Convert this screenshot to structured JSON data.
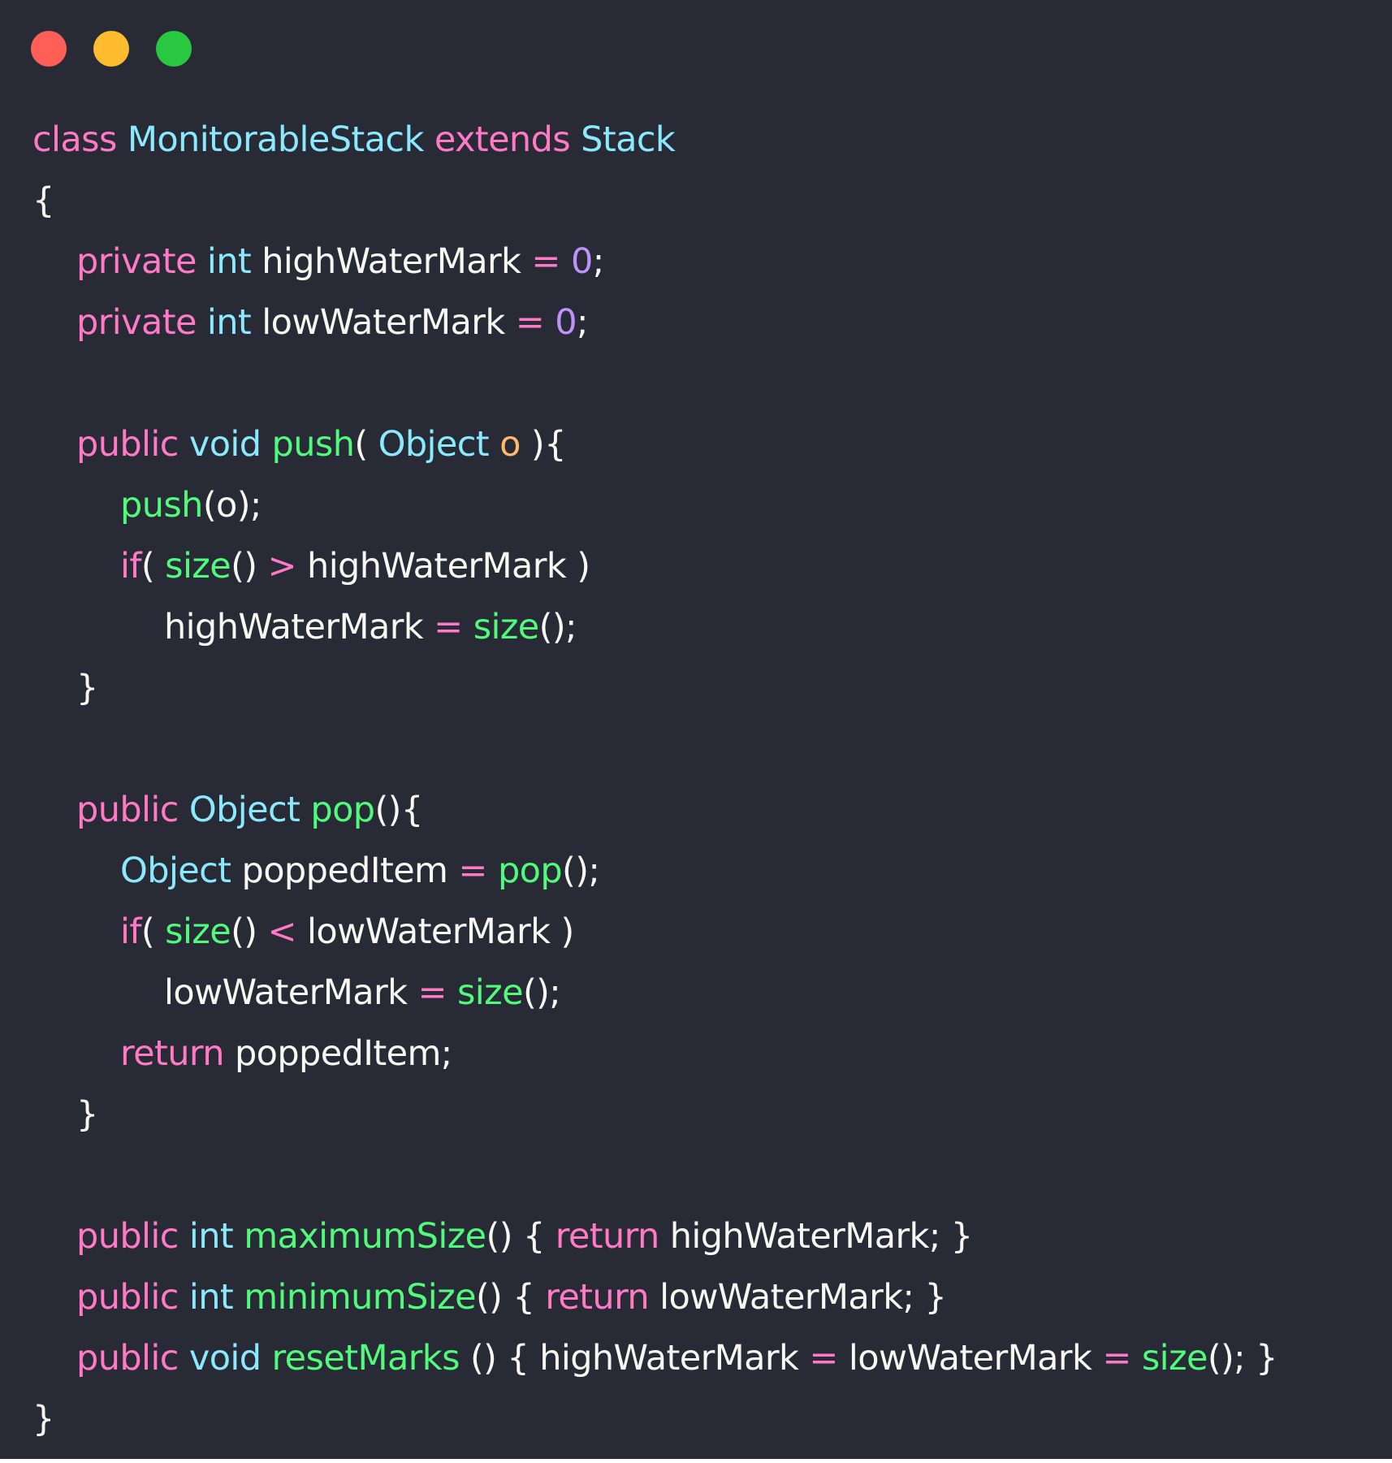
{
  "window": {
    "controls": {
      "close_color": "#ff5f57",
      "minimize_color": "#febc2e",
      "zoom_color": "#28c840"
    }
  },
  "theme": {
    "background": "#282a36",
    "text": "#f8f8f2",
    "keyword": "#ff79c6",
    "type": "#8be9fd",
    "function": "#50fa7b",
    "number": "#bd93f9",
    "parameter": "#ffb86c"
  },
  "code": {
    "lines": [
      {
        "indent": 0,
        "tokens": [
          {
            "t": "class ",
            "c": "kw"
          },
          {
            "t": "MonitorableStack",
            "c": "ty"
          },
          {
            "t": " ",
            "c": "tx"
          },
          {
            "t": "extends",
            "c": "kw"
          },
          {
            "t": " ",
            "c": "tx"
          },
          {
            "t": "Stack",
            "c": "ty"
          }
        ]
      },
      {
        "indent": 0,
        "tokens": [
          {
            "t": "{",
            "c": "tx"
          }
        ]
      },
      {
        "indent": 1,
        "tokens": [
          {
            "t": "private",
            "c": "kw"
          },
          {
            "t": " ",
            "c": "tx"
          },
          {
            "t": "int",
            "c": "ty"
          },
          {
            "t": " highWaterMark ",
            "c": "tx"
          },
          {
            "t": "=",
            "c": "op"
          },
          {
            "t": " ",
            "c": "tx"
          },
          {
            "t": "0",
            "c": "num"
          },
          {
            "t": ";",
            "c": "tx"
          }
        ]
      },
      {
        "indent": 1,
        "tokens": [
          {
            "t": "private",
            "c": "kw"
          },
          {
            "t": " ",
            "c": "tx"
          },
          {
            "t": "int",
            "c": "ty"
          },
          {
            "t": " lowWaterMark ",
            "c": "tx"
          },
          {
            "t": "=",
            "c": "op"
          },
          {
            "t": " ",
            "c": "tx"
          },
          {
            "t": "0",
            "c": "num"
          },
          {
            "t": ";",
            "c": "tx"
          }
        ]
      },
      {
        "indent": 0,
        "tokens": []
      },
      {
        "indent": 1,
        "tokens": [
          {
            "t": "public",
            "c": "kw"
          },
          {
            "t": " ",
            "c": "tx"
          },
          {
            "t": "void",
            "c": "ty"
          },
          {
            "t": " ",
            "c": "tx"
          },
          {
            "t": "push",
            "c": "fn"
          },
          {
            "t": "( ",
            "c": "tx"
          },
          {
            "t": "Object",
            "c": "ty"
          },
          {
            "t": " ",
            "c": "tx"
          },
          {
            "t": "o",
            "c": "prm"
          },
          {
            "t": " ){",
            "c": "tx"
          }
        ]
      },
      {
        "indent": 2,
        "tokens": [
          {
            "t": "push",
            "c": "fn"
          },
          {
            "t": "(o);",
            "c": "tx"
          }
        ]
      },
      {
        "indent": 2,
        "tokens": [
          {
            "t": "if",
            "c": "kw"
          },
          {
            "t": "( ",
            "c": "tx"
          },
          {
            "t": "size",
            "c": "fn"
          },
          {
            "t": "() ",
            "c": "tx"
          },
          {
            "t": ">",
            "c": "op"
          },
          {
            "t": " highWaterMark )",
            "c": "tx"
          }
        ]
      },
      {
        "indent": 3,
        "tokens": [
          {
            "t": "highWaterMark ",
            "c": "tx"
          },
          {
            "t": "=",
            "c": "op"
          },
          {
            "t": " ",
            "c": "tx"
          },
          {
            "t": "size",
            "c": "fn"
          },
          {
            "t": "();",
            "c": "tx"
          }
        ]
      },
      {
        "indent": 1,
        "tokens": [
          {
            "t": "}",
            "c": "tx"
          }
        ]
      },
      {
        "indent": 0,
        "tokens": []
      },
      {
        "indent": 1,
        "tokens": [
          {
            "t": "public",
            "c": "kw"
          },
          {
            "t": " ",
            "c": "tx"
          },
          {
            "t": "Object",
            "c": "ty"
          },
          {
            "t": " ",
            "c": "tx"
          },
          {
            "t": "pop",
            "c": "fn"
          },
          {
            "t": "(){",
            "c": "tx"
          }
        ]
      },
      {
        "indent": 2,
        "tokens": [
          {
            "t": "Object",
            "c": "ty"
          },
          {
            "t": " poppedItem ",
            "c": "tx"
          },
          {
            "t": "=",
            "c": "op"
          },
          {
            "t": " ",
            "c": "tx"
          },
          {
            "t": "pop",
            "c": "fn"
          },
          {
            "t": "();",
            "c": "tx"
          }
        ]
      },
      {
        "indent": 2,
        "tokens": [
          {
            "t": "if",
            "c": "kw"
          },
          {
            "t": "( ",
            "c": "tx"
          },
          {
            "t": "size",
            "c": "fn"
          },
          {
            "t": "() ",
            "c": "tx"
          },
          {
            "t": "<",
            "c": "op"
          },
          {
            "t": " lowWaterMark )",
            "c": "tx"
          }
        ]
      },
      {
        "indent": 3,
        "tokens": [
          {
            "t": "lowWaterMark ",
            "c": "tx"
          },
          {
            "t": "=",
            "c": "op"
          },
          {
            "t": " ",
            "c": "tx"
          },
          {
            "t": "size",
            "c": "fn"
          },
          {
            "t": "();",
            "c": "tx"
          }
        ]
      },
      {
        "indent": 2,
        "tokens": [
          {
            "t": "return",
            "c": "kw"
          },
          {
            "t": " poppedItem;",
            "c": "tx"
          }
        ]
      },
      {
        "indent": 1,
        "tokens": [
          {
            "t": "}",
            "c": "tx"
          }
        ]
      },
      {
        "indent": 0,
        "tokens": []
      },
      {
        "indent": 1,
        "tokens": [
          {
            "t": "public",
            "c": "kw"
          },
          {
            "t": " ",
            "c": "tx"
          },
          {
            "t": "int",
            "c": "ty"
          },
          {
            "t": " ",
            "c": "tx"
          },
          {
            "t": "maximumSize",
            "c": "fn"
          },
          {
            "t": "() { ",
            "c": "tx"
          },
          {
            "t": "return",
            "c": "kw"
          },
          {
            "t": " highWaterMark; }",
            "c": "tx"
          }
        ]
      },
      {
        "indent": 1,
        "tokens": [
          {
            "t": "public",
            "c": "kw"
          },
          {
            "t": " ",
            "c": "tx"
          },
          {
            "t": "int",
            "c": "ty"
          },
          {
            "t": " ",
            "c": "tx"
          },
          {
            "t": "minimumSize",
            "c": "fn"
          },
          {
            "t": "() { ",
            "c": "tx"
          },
          {
            "t": "return",
            "c": "kw"
          },
          {
            "t": " lowWaterMark; }",
            "c": "tx"
          }
        ]
      },
      {
        "indent": 1,
        "tokens": [
          {
            "t": "public",
            "c": "kw"
          },
          {
            "t": " ",
            "c": "tx"
          },
          {
            "t": "void",
            "c": "ty"
          },
          {
            "t": " ",
            "c": "tx"
          },
          {
            "t": "resetMarks",
            "c": "fn"
          },
          {
            "t": " () { highWaterMark ",
            "c": "tx"
          },
          {
            "t": "=",
            "c": "op"
          },
          {
            "t": " lowWaterMark ",
            "c": "tx"
          },
          {
            "t": "=",
            "c": "op"
          },
          {
            "t": " ",
            "c": "tx"
          },
          {
            "t": "size",
            "c": "fn"
          },
          {
            "t": "(); }",
            "c": "tx"
          }
        ]
      },
      {
        "indent": 0,
        "tokens": [
          {
            "t": "}",
            "c": "tx"
          }
        ]
      }
    ]
  }
}
